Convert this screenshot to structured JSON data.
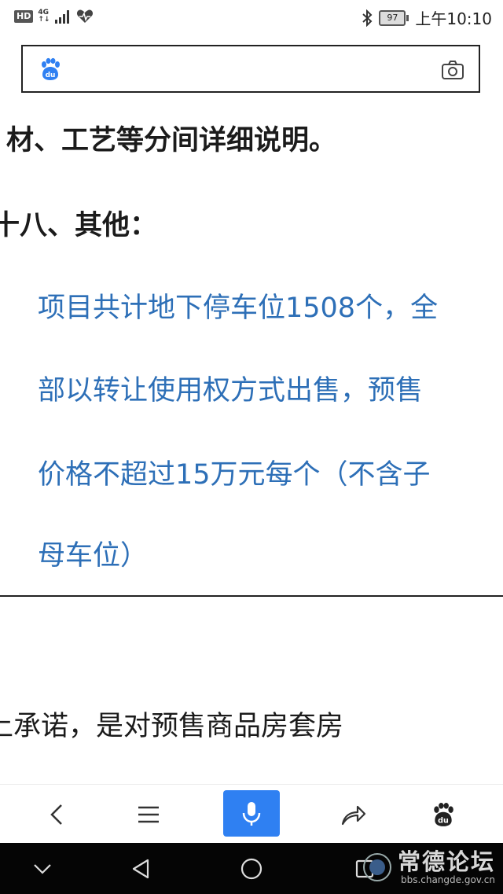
{
  "status_bar": {
    "hd": "HD",
    "network_top": "4G",
    "network_bottom": "↑↓",
    "battery": "97",
    "time": "上午10:10"
  },
  "search": {
    "logo": "du"
  },
  "article": {
    "line1": "材、工艺等分间详细说明。",
    "line2": "十八、其他：",
    "blue_lines": [
      "项目共计地下停车位1508个，全",
      "部以转让使用权方式出售，预售",
      "价格不超过15万元每个（不含子",
      "母车位）"
    ],
    "line_after": "上承诺，是对预售商品房套房"
  },
  "toolbar": {
    "items": [
      "back-icon",
      "menu-icon",
      "mic-icon",
      "share-icon",
      "baidu-icon"
    ],
    "baidu_logo": "du"
  },
  "nav": {
    "items": [
      "hide-icon",
      "back-triangle-icon",
      "home-circle-icon",
      "recent-square-icon"
    ]
  },
  "watermark": {
    "title": "常德论坛",
    "url": "bbs.changde.gov.cn"
  },
  "colors": {
    "blue_text": "#2d6fb7",
    "accent": "#2f80f2"
  }
}
